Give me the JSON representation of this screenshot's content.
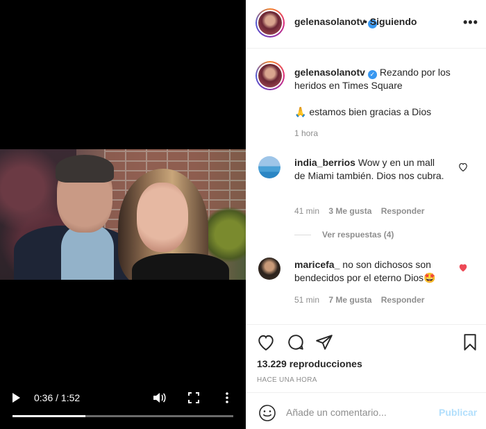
{
  "video": {
    "time": "0:36 / 1:52",
    "progress": 0.33
  },
  "post": {
    "username": "gelenasolanotv",
    "follow_status": "• Siguiendo",
    "more": "•••"
  },
  "caption": {
    "username": "gelenasolanotv",
    "text": "Rezando por los heridos en Times Square",
    "text2": "🙏 estamos bien gracias a Dios",
    "time": "1 hora"
  },
  "comments": [
    {
      "username": "india_berrios",
      "text": "Wow y en un mall de Miami también. Dios nos cubra.",
      "time": "41 min",
      "likes": "3 Me gusta",
      "reply": "Responder",
      "liked": false
    },
    {
      "username": "maricefa_",
      "text": "no son dichosos son bendecidos por el eterno Dios🤩",
      "time": "51 min",
      "likes": "7 Me gusta",
      "reply": "Responder",
      "liked": true
    }
  ],
  "replies_label": "Ver respuestas (4)",
  "stats": {
    "views": "13.229 reproducciones",
    "posted": "HACE UNA HORA"
  },
  "comment_box": {
    "placeholder": "Añade un comentario...",
    "publish": "Publicar"
  },
  "colors": {
    "link_blue": "#3897f0",
    "publish_disabled": "#b2dffc",
    "like_red": "#ed4956"
  }
}
